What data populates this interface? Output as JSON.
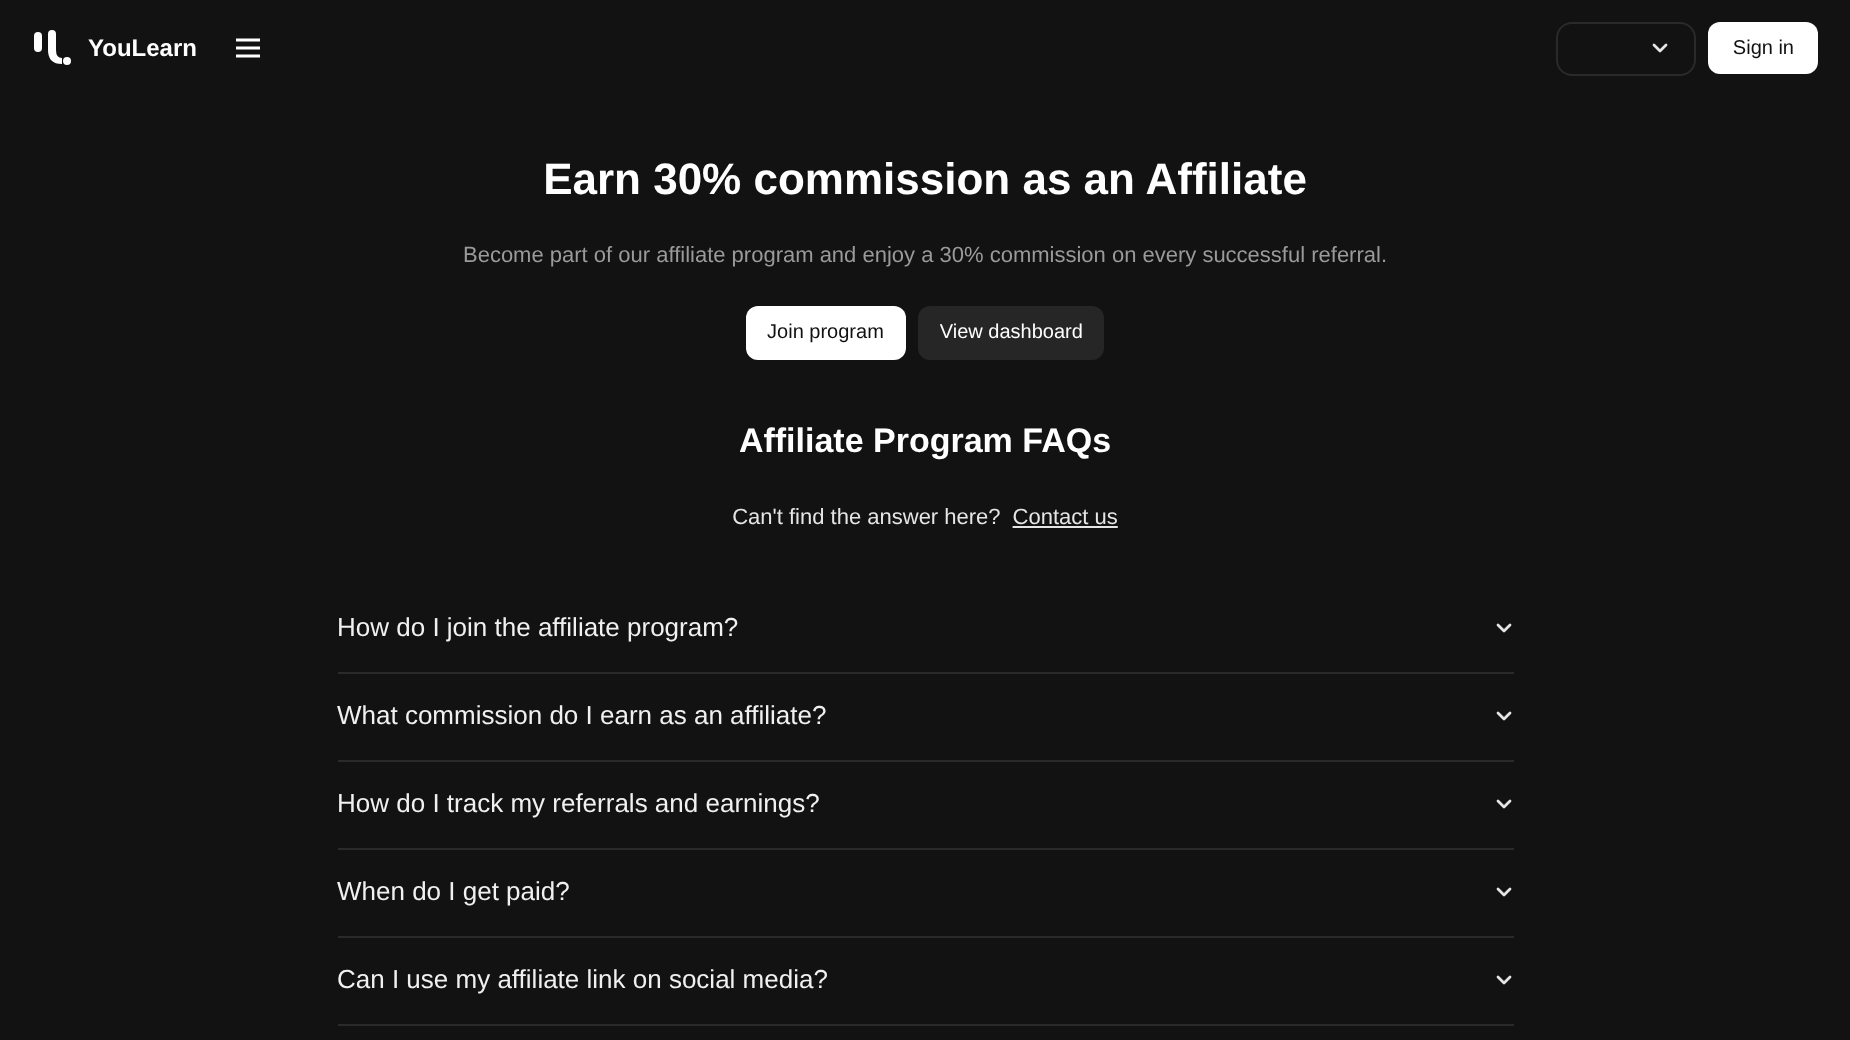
{
  "header": {
    "logo_text": "YouLearn",
    "sign_in": "Sign in"
  },
  "hero": {
    "title": "Earn 30% commission as an Affiliate",
    "subtitle": "Become part of our affiliate program and enjoy a 30% commission on every successful referral.",
    "buttons": [
      {
        "label": "Join program",
        "kind": "primary"
      },
      {
        "label": "View dashboard",
        "kind": "secondary"
      }
    ]
  },
  "faq": {
    "title": "Affiliate Program FAQs",
    "note": "Can't find the answer here?",
    "link": "Contact us",
    "items": [
      {
        "question": "How do I join the affiliate program?",
        "expanded": false
      },
      {
        "question": "What commission do I earn as an affiliate?",
        "expanded": false
      },
      {
        "question": "How do I track my referrals and earnings?",
        "expanded": false
      },
      {
        "question": "When do I get paid?",
        "expanded": false
      },
      {
        "question": "Can I use my affiliate link on social media?",
        "expanded": false
      }
    ]
  }
}
